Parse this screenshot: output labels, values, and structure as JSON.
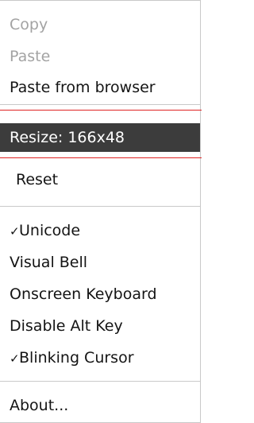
{
  "menu": {
    "items": [
      {
        "label": "Copy",
        "state": "disabled"
      },
      {
        "label": "Paste",
        "state": "disabled"
      },
      {
        "label": "Paste from browser",
        "state": "enabled"
      },
      {
        "label": "Resize: 166x48",
        "state": "highlighted"
      },
      {
        "label": "Reset",
        "state": "enabled"
      },
      {
        "label": "Unicode",
        "checked": true,
        "check": "✓"
      },
      {
        "label": "Visual Bell",
        "checked": false
      },
      {
        "label": "Onscreen Keyboard",
        "checked": false
      },
      {
        "label": "Disable Alt Key",
        "checked": false
      },
      {
        "label": "Blinking Cursor",
        "checked": true,
        "check": "✓"
      },
      {
        "label": "About...",
        "state": "enabled"
      }
    ]
  },
  "colors": {
    "highlight_bg": "#3c3c3c",
    "highlight_text": "#ffffff",
    "disabled_text": "#a3a3a3",
    "text": "#141414",
    "separator": "#c9c9c9",
    "annotation_line": "#e02424"
  }
}
